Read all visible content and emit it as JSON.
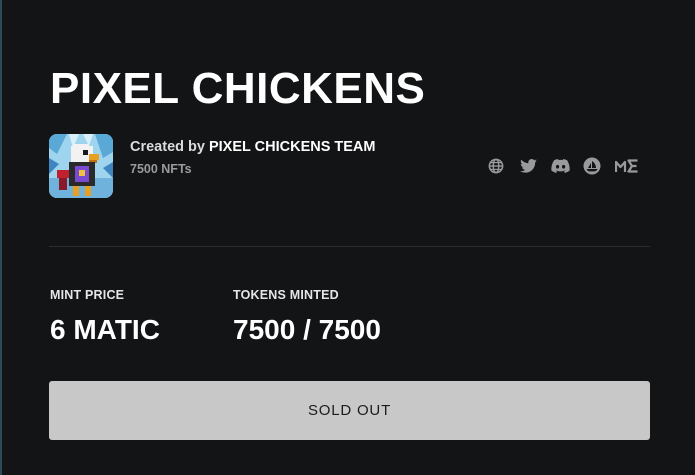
{
  "collection": {
    "title": "PIXEL CHICKENS",
    "created_by_prefix": "Created by",
    "creator_name": "PIXEL CHICKENS TEAM",
    "nft_count": "7500 NFTs"
  },
  "socials": [
    {
      "icon": "globe-icon"
    },
    {
      "icon": "twitter-icon"
    },
    {
      "icon": "discord-icon"
    },
    {
      "icon": "opensea-icon"
    },
    {
      "icon": "magic-eden-icon"
    }
  ],
  "stats": {
    "mint_price_label": "MINT PRICE",
    "mint_price_value": "6 MATIC",
    "tokens_minted_label": "TOKENS MINTED",
    "tokens_minted_value": "7500 / 7500"
  },
  "action": {
    "label": "SOLD OUT"
  },
  "colors": {
    "background": "#131416",
    "button": "#c8c8c8",
    "muted_text": "#9b9b9b"
  }
}
